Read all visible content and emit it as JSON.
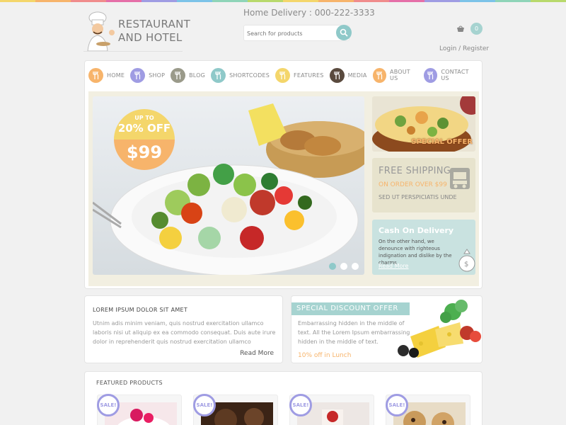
{
  "brand": {
    "line1": "RESTAURANT",
    "line2": "AND HOTEL"
  },
  "header": {
    "phone": "Home Delivery :  000-222-3333",
    "search_placeholder": "Search for products",
    "cart_count": "0",
    "login": "Login / Register"
  },
  "rainbow": [
    "#f4d66b",
    "#f7b46b",
    "#f08c8c",
    "#e56fa8",
    "#9f9ce3",
    "#7cc3e8",
    "#8fd4b8",
    "#b8d96c",
    "#f4d66b",
    "#f7b46b",
    "#f08c8c",
    "#e56fa8",
    "#9f9ce3",
    "#7cc3e8",
    "#8fd4b8",
    "#b8d96c"
  ],
  "nav": [
    {
      "label": "HOME",
      "color": "#f7b46b",
      "icon": "home-icon"
    },
    {
      "label": "SHOP",
      "color": "#9f9ce3",
      "icon": "shop-icon"
    },
    {
      "label": "BLOG",
      "color": "#9a9a8a",
      "icon": "blog-icon"
    },
    {
      "label": "SHORTCODES",
      "color": "#8fc9c9",
      "icon": "shortcodes-icon"
    },
    {
      "label": "FEATURES",
      "color": "#f4d66b",
      "icon": "features-icon"
    },
    {
      "label": "MEDIA",
      "color": "#5a4a3e",
      "icon": "media-icon"
    },
    {
      "label": "ABOUT US",
      "color": "#f7b46b",
      "icon": "about-icon"
    },
    {
      "label": "CONTACT US",
      "color": "#9f9ce3",
      "icon": "contact-icon"
    }
  ],
  "hero": {
    "badge_top": "UP TO",
    "badge_pct": "20% OFF",
    "badge_price": "$99",
    "slides": 3,
    "active_slide": 1
  },
  "special_offer": {
    "label": "SPECIAL OFFER"
  },
  "shipping": {
    "title": "FREE SHIPPING",
    "subtitle": "ON ORDER OVER $99",
    "note": "SED UT PERSPICIATIS UNDE"
  },
  "cod": {
    "title": "Cash On Delivery",
    "body": "On the other hand, we denounce with righteous indignation and dislike by the charms",
    "more": "Read More"
  },
  "lorem": {
    "title": "LOREM IPSUM DOLOR SIT AMET",
    "body": "Utnim adis minim veniam, quis nostrud exercitation ullamco laboris nisi ut aliquip ex ea commodo consequat. Duis aute irure dolor in reprehenderit quis nostrud exercitation ullamco",
    "more": "Read More"
  },
  "discount": {
    "title": "SPECIAL DISCOUNT OFFER",
    "body": "Embarrassing hidden in the middle of text. All the Lorem Ipsum embarrassing hidden in the middle of text.",
    "off": "10% off in Lunch"
  },
  "featured": {
    "title": "FEATURED PRODUCTS",
    "products": [
      {
        "sale": "SALE!"
      },
      {
        "sale": "SALE!"
      },
      {
        "sale": "SALE!"
      },
      {
        "sale": "SALE!"
      }
    ]
  }
}
